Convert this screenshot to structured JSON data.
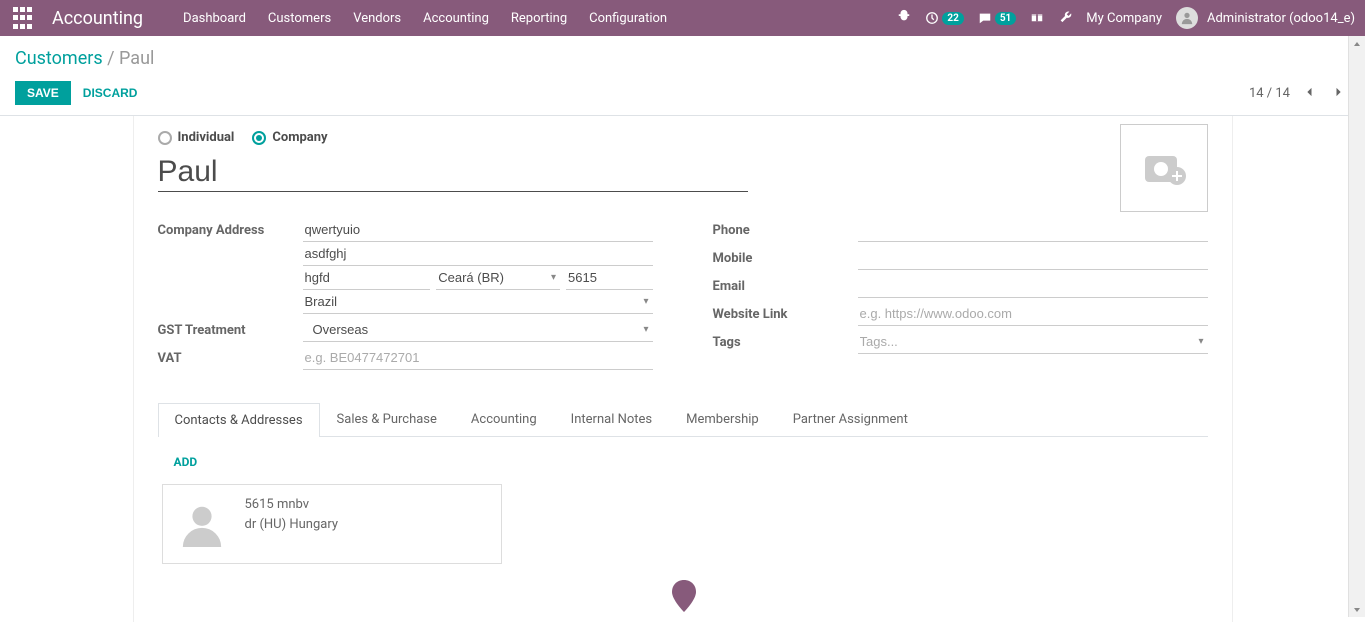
{
  "nav": {
    "brand": "Accounting",
    "items": [
      "Dashboard",
      "Customers",
      "Vendors",
      "Accounting",
      "Reporting",
      "Configuration"
    ],
    "badge1": "22",
    "badge2": "51",
    "company": "My Company",
    "user": "Administrator (odoo14_e)"
  },
  "breadcrumb": {
    "root": "Customers",
    "current": "Paul"
  },
  "buttons": {
    "save": "SAVE",
    "discard": "DISCARD"
  },
  "pager": {
    "text": "14 / 14"
  },
  "form": {
    "radio": {
      "individual": "Individual",
      "company": "Company",
      "selected": "company"
    },
    "name": "Paul",
    "labels": {
      "company_address": "Company Address",
      "gst": "GST Treatment",
      "vat": "VAT",
      "phone": "Phone",
      "mobile": "Mobile",
      "email": "Email",
      "website": "Website Link",
      "tags": "Tags"
    },
    "address": {
      "street": "qwertyuio",
      "street2": "asdfghj",
      "city": "hgfd",
      "state": "Ceará (BR)",
      "zip": "5615",
      "country": "Brazil"
    },
    "gst_value": "Overseas",
    "vat_placeholder": "e.g. BE0477472701",
    "website_placeholder": "e.g. https://www.odoo.com",
    "tags_placeholder": "Tags..."
  },
  "tabs": [
    "Contacts & Addresses",
    "Sales & Purchase",
    "Accounting",
    "Internal Notes",
    "Membership",
    "Partner Assignment"
  ],
  "tab_body": {
    "add": "ADD",
    "contact": {
      "line1": "5615 mnbv",
      "line2": "dr (HU) Hungary"
    }
  }
}
